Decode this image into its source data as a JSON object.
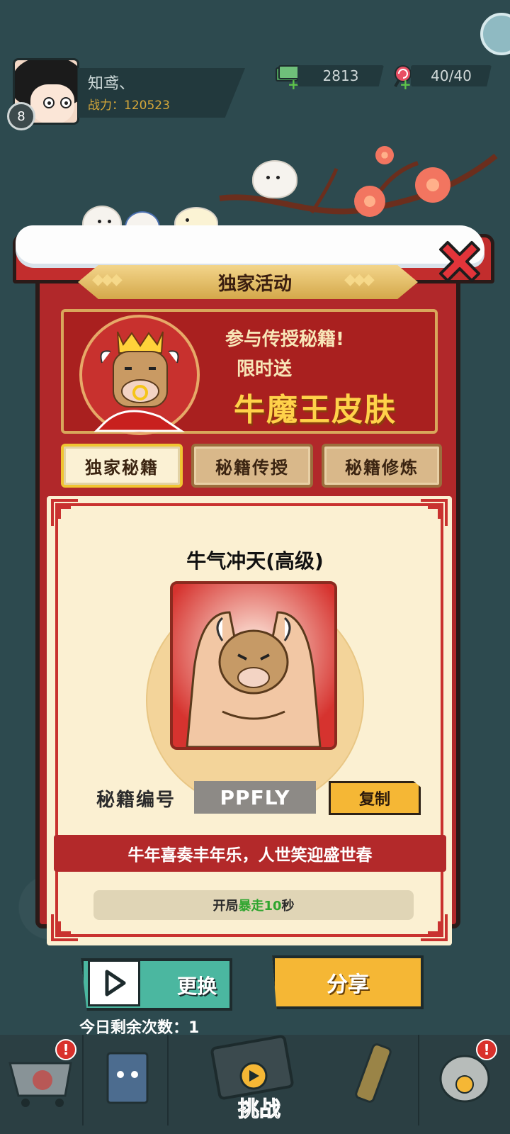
{
  "player": {
    "name": "知鸢、",
    "power_label": "战力：120523",
    "level": "8"
  },
  "resources": {
    "money": "2813",
    "energy": "40/40"
  },
  "panel": {
    "title": "独家活动",
    "banner_line1": "参与传授秘籍!",
    "banner_line2": "限时送",
    "banner_line3": "牛魔王皮肤"
  },
  "tabs": [
    {
      "label": "独家秘籍",
      "active": true
    },
    {
      "label": "秘籍传授",
      "active": false
    },
    {
      "label": "秘籍修炼",
      "active": false
    }
  ],
  "skill": {
    "title": "牛气冲天(高级)",
    "code_label": "秘籍编号",
    "code_value": "PPFLY",
    "copy_label": "复制",
    "motto": "牛年喜奏丰年乐，人世笑迎盛世春",
    "effect_prefix": "开局",
    "effect_highlight": "暴走10",
    "effect_suffix": "秒"
  },
  "actions": {
    "replace_label": "更换",
    "share_label": "分享",
    "remaining_label": "今日剩余次数：1"
  },
  "bottom_nav": {
    "challenge_label": "挑战"
  },
  "colors": {
    "panel_red": "#b1282a",
    "gold": "#f5b735",
    "teal": "#4bb7a0",
    "background": "#2d4a4f"
  }
}
